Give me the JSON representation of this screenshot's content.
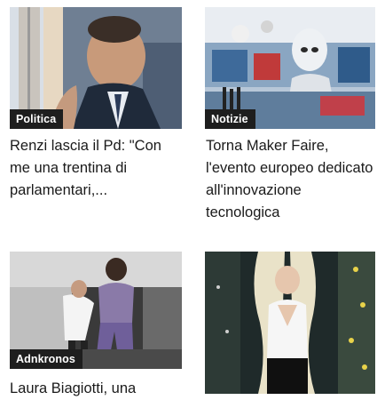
{
  "cards": [
    {
      "category": "Politica",
      "title": "Renzi lascia il Pd: \"Con me una trentina di parlamentari,..."
    },
    {
      "category": "Notizie",
      "title": "Torna Maker Faire, l'evento europeo dedicato all'innovazione tecnologica"
    },
    {
      "category": "Adnkronos",
      "title": "Laura Biagiotti, una"
    },
    {
      "category": "",
      "title": ""
    }
  ]
}
